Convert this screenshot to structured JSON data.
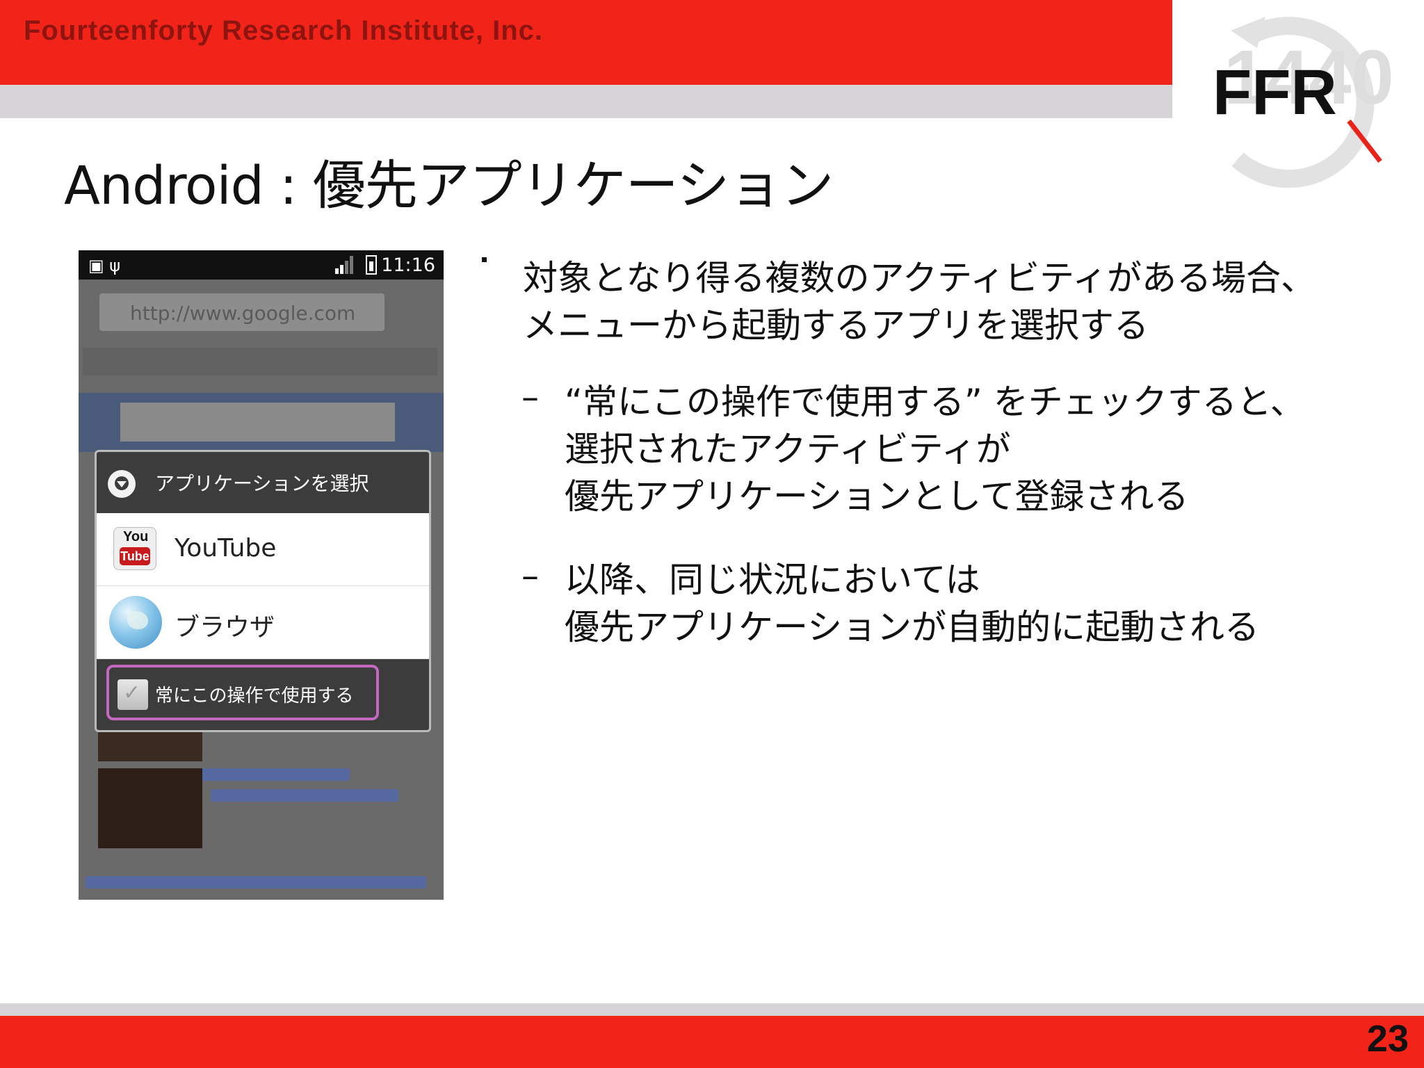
{
  "header": {
    "company": "Fourteenforty Research Institute, Inc.",
    "logo_text": "FFR"
  },
  "slide": {
    "title": "Android : 優先アプリケーション",
    "page_number": "23"
  },
  "phone": {
    "status_time": "11:16",
    "bg_url_text": "http://www.google.com",
    "dialog": {
      "title": "アプリケーションを選択",
      "options": [
        {
          "label": "YouTube",
          "icon": "youtube-icon"
        },
        {
          "label": "ブラウザ",
          "icon": "globe-icon"
        }
      ],
      "checkbox_label": "常にこの操作で使用する",
      "checkbox_checked": false
    },
    "highlight_color": "#c36ac0"
  },
  "bullets": {
    "main_line1": "対象となり得る複数のアクティビティがある場合、",
    "main_line2": "メニューから起動するアプリを選択する",
    "sub1_line1": "“常にこの操作で使用する” をチェックすると、",
    "sub1_line2": "選択されたアクティビティが",
    "sub1_line3": "優先アプリケーションとして登録される",
    "sub2_line1": "以降、同じ状況においては",
    "sub2_line2": "優先アプリケーションが自動的に起動される",
    "dash": "–"
  },
  "colors": {
    "brand_red": "#f2241a",
    "band_grey": "#d6d4d6",
    "company_text": "#8e1410"
  }
}
